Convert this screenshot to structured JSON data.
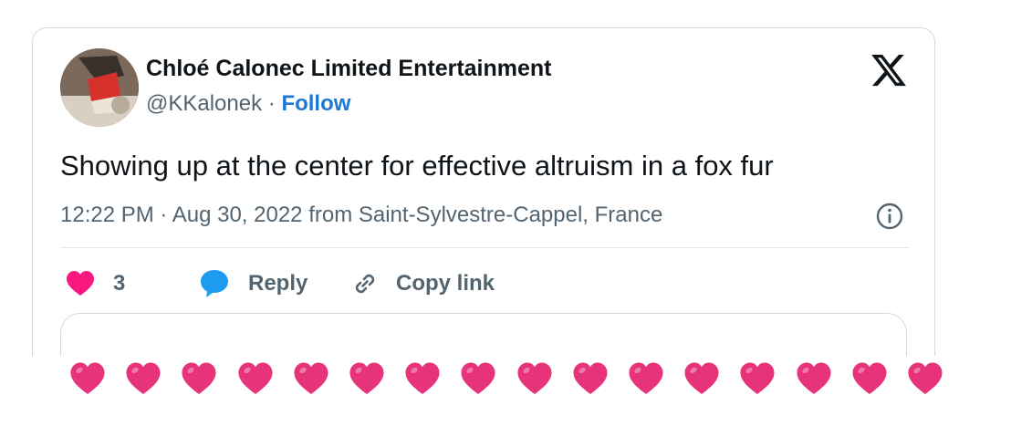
{
  "tweet": {
    "author_name": "Chloé Calonec Limited Entertainment",
    "handle": "@KKalonek",
    "separator": " · ",
    "follow_label": "Follow",
    "text": "Showing up at the center for effective altruism in a fox fur",
    "timestamp": "12:22 PM · Aug 30, 2022 from Saint-Sylvestre-Cappel, France",
    "like_count": "3",
    "reply_label": "Reply",
    "copy_link_label": "Copy link"
  },
  "hearts_row": {
    "count": 16,
    "color": "#e6337a"
  },
  "colors": {
    "like_heart": "#f91880",
    "reply_icon": "#1d9bf0",
    "follow": "#1d78d6",
    "muted": "#536471"
  }
}
